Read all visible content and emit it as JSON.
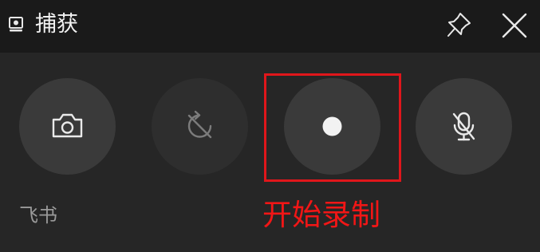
{
  "window": {
    "title": "捕获",
    "title_icon": "capture-widget-icon",
    "pin_icon": "pin-icon",
    "close_icon": "close-icon"
  },
  "buttons": {
    "screenshot": {
      "icon": "camera-icon"
    },
    "recent_capture": {
      "icon": "rotate-disabled-icon",
      "enabled": false
    },
    "record": {
      "icon": "record-dot-icon"
    },
    "microphone": {
      "icon": "microphone-off-icon"
    }
  },
  "app_label": "飞书",
  "annotation": {
    "text": "开始录制",
    "color": "#e0161b"
  },
  "colors": {
    "titlebar": "#1a1a1a",
    "panel": "#262626",
    "button": "#3a3a3a",
    "highlight": "#e0161b"
  }
}
